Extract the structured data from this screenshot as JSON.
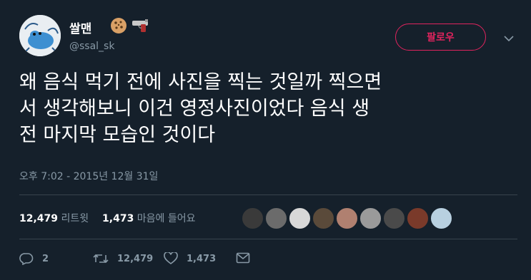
{
  "user": {
    "display_name": "쌀맨",
    "handle": "@ssal_sk",
    "name_emojis": [
      "cookie-icon",
      "water-pistol-icon"
    ]
  },
  "follow_button": {
    "label": "팔로우",
    "color": "#e0245e"
  },
  "tweet": {
    "text": "왜  음식 먹기 전에 사진을 찍는 것일까 찍으면\n서 생각해보니 이건 영정사진이었다 음식 생\n전 마지막 모습인 것이다",
    "timestamp": "오후 7:02 - 2015년 12월 31일"
  },
  "stats": {
    "retweet_count": "12,479",
    "retweet_label": "리트윗",
    "like_count": "1,473",
    "like_label": "마음에 들어요"
  },
  "liker_avatar_colors": [
    "#3a3a3a",
    "#6b6b6b",
    "#d8d8d8",
    "#5a4a3a",
    "#b08070",
    "#9a9a9a",
    "#4a4a4a",
    "#7a3a2a",
    "#b8d0e0"
  ],
  "actions": {
    "reply_count": "2",
    "retweet_count": "12,479",
    "like_count": "1,473"
  },
  "colors": {
    "background": "#15202b",
    "secondary_text": "#8899a6",
    "divider": "#38444d"
  }
}
